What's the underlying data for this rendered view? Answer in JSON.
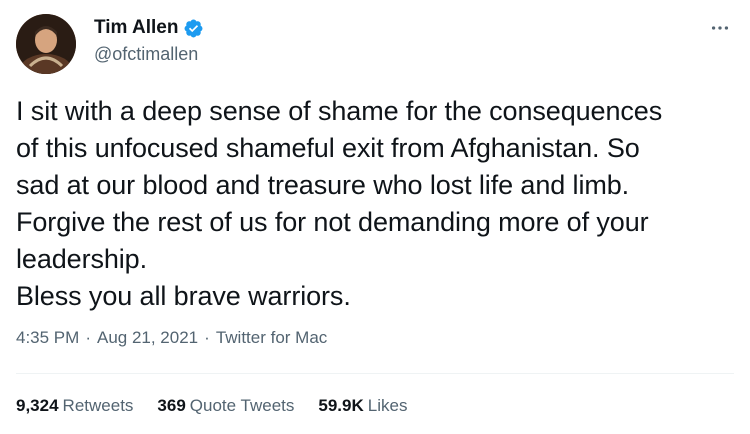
{
  "tweet": {
    "author": {
      "name": "Tim Allen",
      "handle": "@ofctimallen",
      "verified": true
    },
    "text": "I sit with a deep sense of shame for the consequences\nof this unfocused shameful exit from Afghanistan. So\nsad at our blood and treasure who lost life and limb.\nForgive the rest of us for not demanding more of your\nleadership.\nBless you all brave warriors.",
    "time": "4:35 PM",
    "separator": "·",
    "date": "Aug 21, 2021",
    "source": "Twitter for Mac",
    "stats": {
      "retweets": {
        "count": "9,324",
        "label": "Retweets"
      },
      "quote_tweets": {
        "count": "369",
        "label": "Quote Tweets"
      },
      "likes": {
        "count": "59.9K",
        "label": "Likes"
      }
    }
  },
  "icons": {
    "more": "more-horizontal-icon",
    "verified": "verified-badge-icon"
  },
  "colors": {
    "text_primary": "#0f1419",
    "text_secondary": "#536471",
    "verified_blue": "#1d9bf0",
    "divider": "#eff3f4"
  }
}
